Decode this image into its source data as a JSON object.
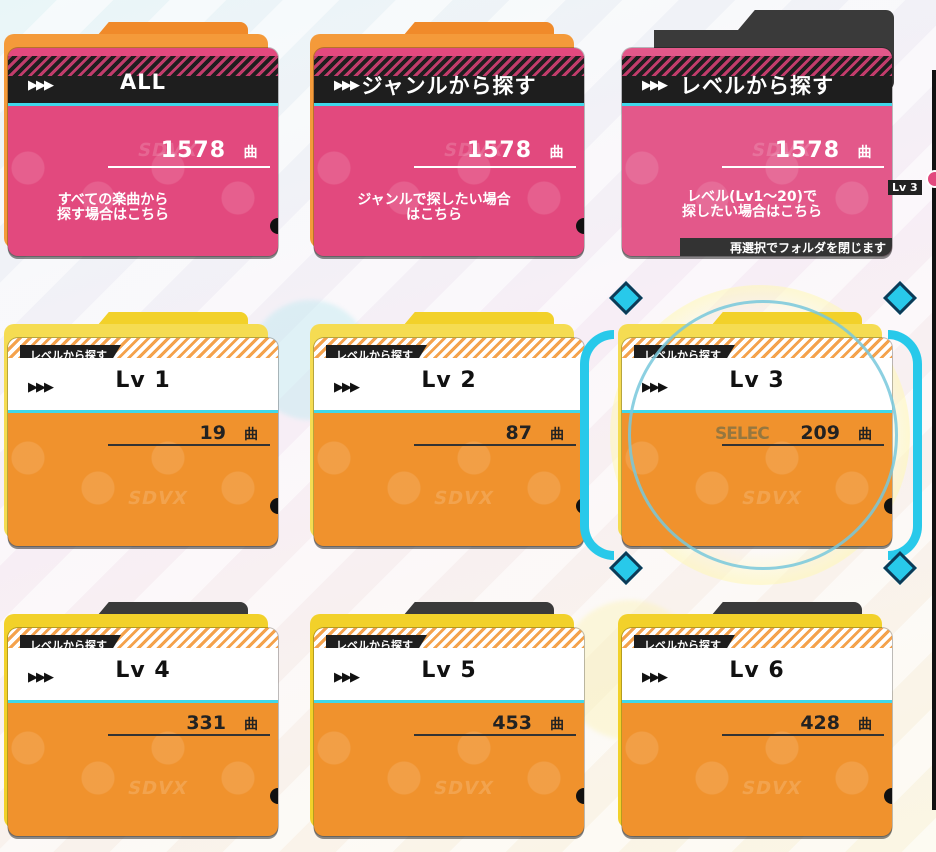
{
  "category_folders": [
    {
      "title": "ALL",
      "count": "1578",
      "desc_line1": "すべての楽曲から",
      "desc_line2": "探す場合はこちら"
    },
    {
      "title": "ジャンルから探す",
      "count": "1578",
      "desc_line1": "ジャンルで探したい場合",
      "desc_line2": "はこちら"
    },
    {
      "title": "レベルから探す",
      "count": "1578",
      "desc_line1": "レベル(Lv1～20)で",
      "desc_line2": "探したい場合はこちら",
      "notice": "再選択でフォルダを閉じます"
    }
  ],
  "level_folders": [
    {
      "label": "レベルから探す",
      "title": "Lv 1",
      "count": "19"
    },
    {
      "label": "レベルから探す",
      "title": "Lv 2",
      "count": "87"
    },
    {
      "label": "レベルから探す",
      "title": "Lv 3",
      "count": "209",
      "selected": true
    },
    {
      "label": "レベルから探す",
      "title": "Lv 4",
      "count": "331"
    },
    {
      "label": "レベルから探す",
      "title": "Lv 5",
      "count": "453"
    },
    {
      "label": "レベルから探す",
      "title": "Lv 6",
      "count": "428"
    }
  ],
  "song_unit_icon": "曲",
  "arrow_glyph": "▶▶▶",
  "watermark": "SDVX",
  "selection_label": "SELEC",
  "scroll_indicator": "Lv 3",
  "colors": {
    "category_pink": "#e2497e",
    "level_orange": "#f0922d",
    "accent_cyan": "#3fd8ea",
    "folder_yellow": "#f2d12a"
  }
}
